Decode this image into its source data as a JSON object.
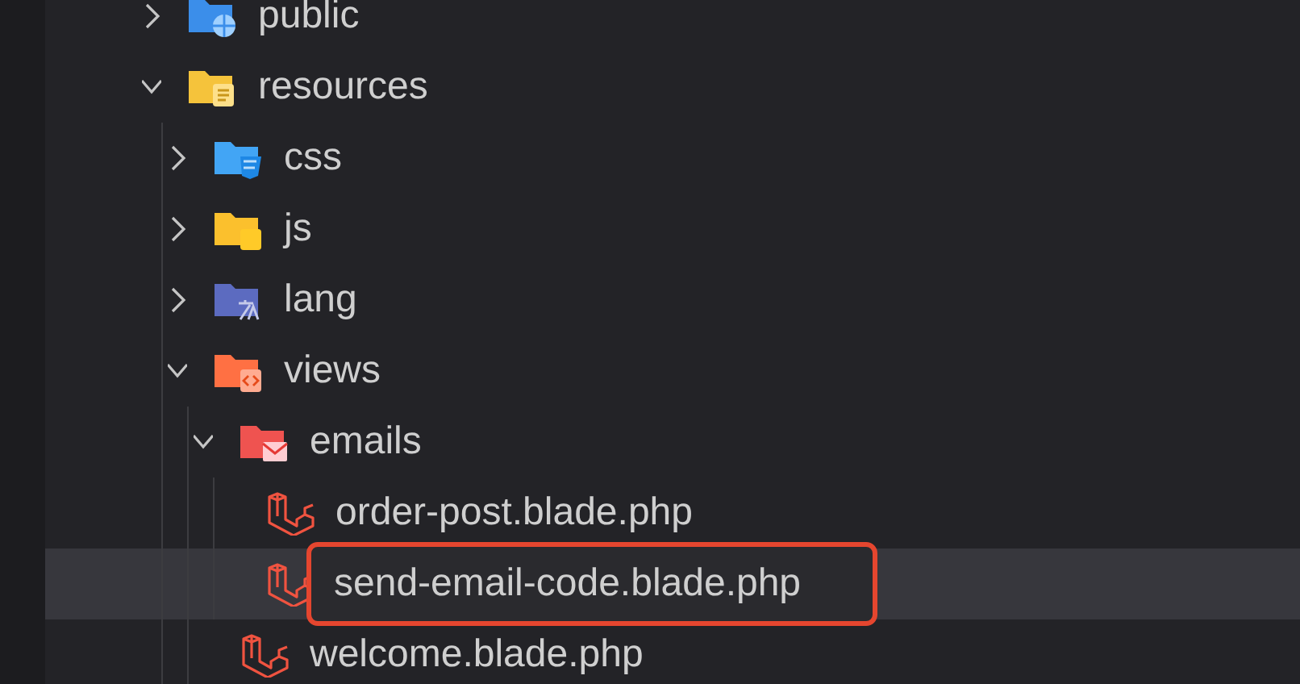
{
  "tree": [
    {
      "name": "public",
      "kind": "folder-web",
      "expanded": false,
      "selected": false
    },
    {
      "name": "resources",
      "kind": "folder-resource",
      "expanded": true,
      "selected": false,
      "children": [
        {
          "name": "css",
          "kind": "folder-css",
          "expanded": false,
          "selected": false
        },
        {
          "name": "js",
          "kind": "folder-js",
          "expanded": false,
          "selected": false
        },
        {
          "name": "lang",
          "kind": "folder-lang",
          "expanded": false,
          "selected": false
        },
        {
          "name": "views",
          "kind": "folder-views",
          "expanded": true,
          "selected": false,
          "children": [
            {
              "name": "emails",
              "kind": "folder-mail",
              "expanded": true,
              "selected": false,
              "children": [
                {
                  "name": "order-post.blade.php",
                  "kind": "file-blade",
                  "selected": false,
                  "annotated": false
                },
                {
                  "name": "send-email-code.blade.php",
                  "kind": "file-blade",
                  "selected": true,
                  "annotated": true
                }
              ]
            },
            {
              "name": "welcome.blade.php",
              "kind": "file-blade",
              "selected": false,
              "annotated": false
            }
          ]
        }
      ]
    }
  ]
}
